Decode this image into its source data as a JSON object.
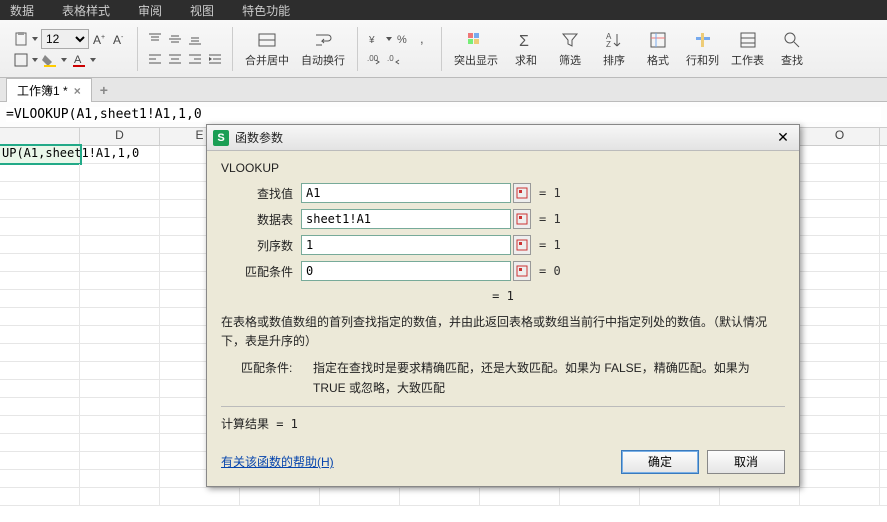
{
  "menu": {
    "items": [
      "数据",
      "表格样式",
      "审阅",
      "视图",
      "特色功能"
    ]
  },
  "ribbon": {
    "font_size": "12",
    "merge_label": "合并居中",
    "wrap_label": "自动换行",
    "highlight_label": "突出显示",
    "sum_label": "求和",
    "filter_label": "筛选",
    "sort_label": "排序",
    "format_label": "格式",
    "rowcol_label": "行和列",
    "sheet_label": "工作表",
    "find_label": "查找"
  },
  "tab": {
    "name": "工作簿1 *",
    "close": "×",
    "add": "+"
  },
  "formula_bar": {
    "value": "=VLOOKUP(A1,sheet1!A1,1,0"
  },
  "sheet": {
    "cols": [
      "",
      "D",
      "E",
      "",
      "",
      "",
      "",
      "",
      "",
      "O"
    ],
    "a1_display": "UP(A1,sheet1!A1,1,0"
  },
  "dialog": {
    "title": "函数参数",
    "func": "VLOOKUP",
    "params": [
      {
        "label": "查找值",
        "value": "A1",
        "result": "= 1"
      },
      {
        "label": "数据表",
        "value": "sheet1!A1",
        "result": "= 1"
      },
      {
        "label": "列序数",
        "value": "1",
        "result": "= 1"
      },
      {
        "label": "匹配条件",
        "value": "0",
        "result": "= 0"
      }
    ],
    "overall_result": "= 1",
    "description": "在表格或数值数组的首列查找指定的数值，并由此返回表格或数组当前行中指定列处的数值。（默认情况下，表是升序的）",
    "param_desc_key": "匹配条件:",
    "param_desc_val": "指定在查找时是要求精确匹配，还是大致匹配。如果为 FALSE，精确匹配。如果为 TRUE 或忽略，大致匹配",
    "calc_label": "计算结果 = 1",
    "help": "有关该函数的帮助(H)",
    "ok": "确定",
    "cancel": "取消"
  }
}
